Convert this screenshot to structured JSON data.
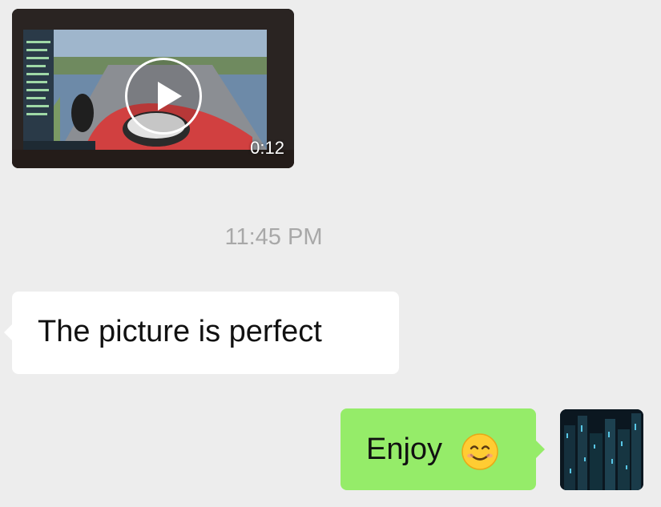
{
  "video_message": {
    "duration": "0:12",
    "thumbnail_icon": "race-car-onboard-video",
    "play_icon": "play-icon"
  },
  "timestamp": "11:45 PM",
  "incoming_message": {
    "text": "The picture is perfect"
  },
  "outgoing_message": {
    "text": "Enjoy",
    "emoji": "smiling-face-icon"
  },
  "avatar": {
    "icon": "city-night-avatar"
  },
  "colors": {
    "background": "#ededed",
    "incoming_bubble": "#ffffff",
    "outgoing_bubble": "#95ec69",
    "timestamp_text": "#a8a8a8"
  }
}
